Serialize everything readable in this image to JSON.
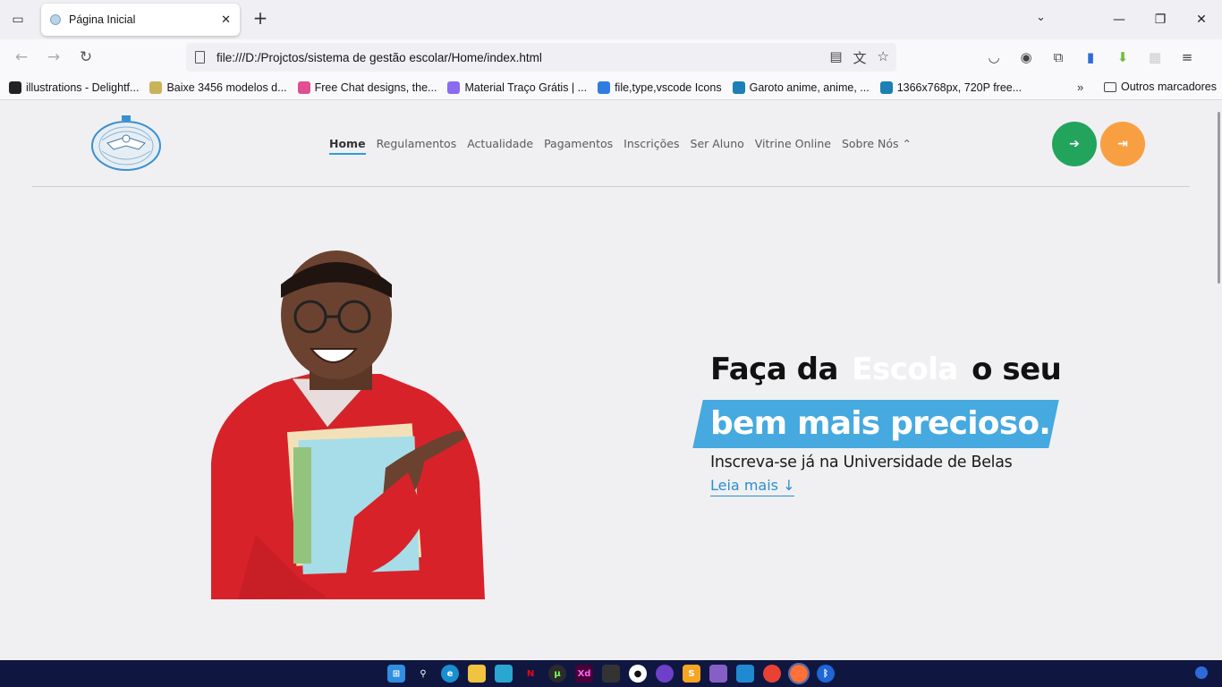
{
  "browser": {
    "tab_title": "Página Inicial",
    "url": "file:///D:/Projctos/sistema de gestão escolar/Home/index.html",
    "bookmarks": [
      {
        "label": "illustrations - Delightf...",
        "color": "#222222"
      },
      {
        "label": "Baixe 3456 modelos d...",
        "color": "#c9b35a"
      },
      {
        "label": "Free Chat designs, the...",
        "color": "#e04f8f"
      },
      {
        "label": "Material Traço Grátis | ...",
        "color": "#8b6cf0"
      },
      {
        "label": "file,type,vscode Icons",
        "color": "#2f7de1"
      },
      {
        "label": "Garoto anime, anime, ...",
        "color": "#1c7fb5"
      },
      {
        "label": "1366x768px, 720P free...",
        "color": "#1c7fb5"
      }
    ],
    "other_bookmarks": "Outros marcadores"
  },
  "site": {
    "menu": [
      {
        "label": "Home",
        "active": true
      },
      {
        "label": "Regulamentos",
        "active": false
      },
      {
        "label": "Actualidade",
        "active": false
      },
      {
        "label": "Pagamentos",
        "active": false
      },
      {
        "label": "Inscrições",
        "active": false
      },
      {
        "label": "Ser Aluno",
        "active": false
      },
      {
        "label": "Vitrine Online",
        "active": false
      },
      {
        "label": "Sobre Nós",
        "active": false
      }
    ],
    "login_icon": "sign-in-icon",
    "logout_icon": "sign-out-icon",
    "colors": {
      "accent": "#46a9e0",
      "green": "#22a45d",
      "orange": "#f8a041"
    }
  },
  "hero": {
    "line1_before": "Faça da",
    "line1_highlight": "Escola",
    "line1_after": "o seu",
    "line2": "bem mais precioso.",
    "subtitle": "Inscreva-se já na Universidade de Belas",
    "cta": "Leia mais ↓"
  }
}
